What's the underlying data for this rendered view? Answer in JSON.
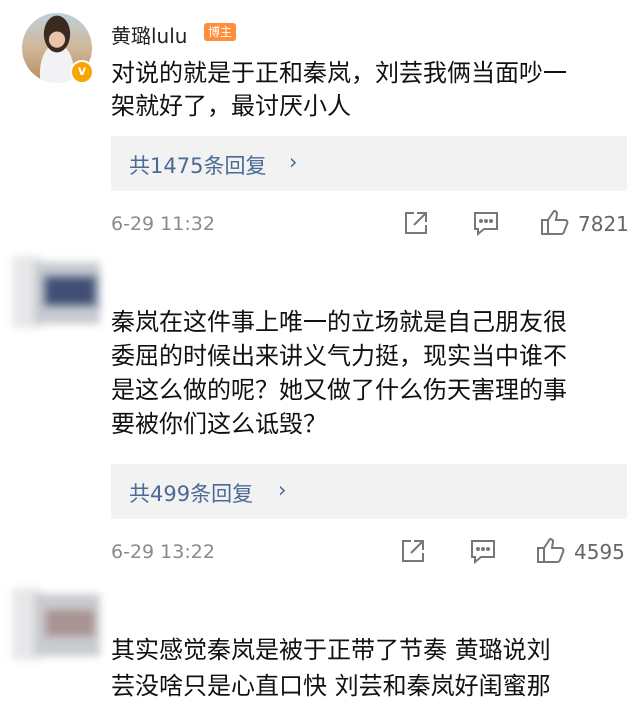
{
  "comments": [
    {
      "username": "黄璐lulu",
      "badge": "博主",
      "verified_mark": "v",
      "lines": [
        "对说的就是于正和秦岚，刘芸我俩当面吵一",
        "架就好了，最讨厌小人"
      ],
      "reply_count_label": "共1475条回复",
      "reply_chevron": "›",
      "time": "6-29 11:32",
      "likes": "7821"
    },
    {
      "lines": [
        "秦岚在这件事上唯一的立场就是自己朋友很",
        "委屈的时候出来讲义气力挺，现实当中谁不",
        "是这么做的呢？她又做了什么伤天害理的事",
        "要被你们这么诋毁？"
      ],
      "reply_count_label": "共499条回复",
      "reply_chevron": "›",
      "time": "6-29 13:22",
      "likes": "4595"
    },
    {
      "lines": [
        "其实感觉秦岚是被于正带了节奏  黄璐说刘",
        "芸没啥只是心直口快  刘芸和秦岚好闺蜜那"
      ]
    }
  ],
  "icons": {
    "share": "share-icon",
    "comment": "comment-icon",
    "like": "thumbs-up-icon",
    "verified": "verified-badge-icon"
  },
  "colors": {
    "reply_link": "#4a6a96",
    "badge": "#ff8d3a",
    "verified": "#f7a600",
    "reply_bg": "#f2f2f2"
  }
}
